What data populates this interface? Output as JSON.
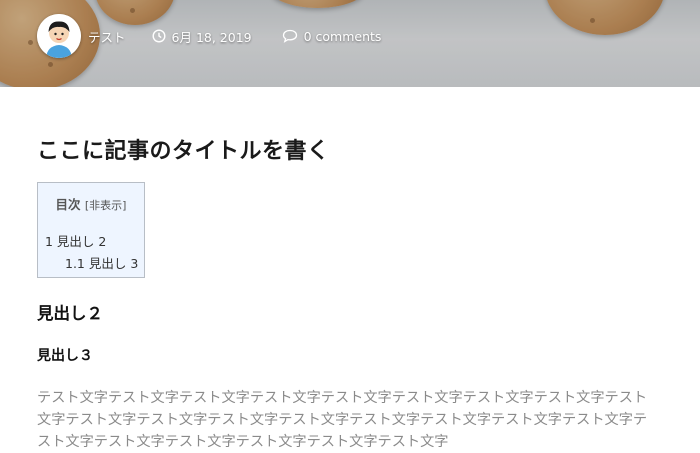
{
  "header": {
    "author": "テスト",
    "date": "6月 18, 2019",
    "comments": "0 comments",
    "icons": [
      "avatar",
      "clock-icon",
      "comment-icon"
    ]
  },
  "article": {
    "title": "ここに記事のタイトルを書く",
    "toc": {
      "heading": "目次",
      "toggle": "[非表示]",
      "items": [
        "1 見出し 2",
        "1.1 見出し 3"
      ]
    },
    "h2": "見出し２",
    "h3": "見出し３",
    "body": "テスト文字テスト文字テスト文字テスト文字テスト文字テスト文字テスト文字テスト文字テスト文字テスト文字テスト文字テスト文字テスト文字テスト文字テスト文字テスト文字テスト文字テスト文字テスト文字テスト文字テスト文字テスト文字テスト文字"
  },
  "colors": {
    "toc_background": "#eef5ff",
    "body_text": "#8a8a8a",
    "title_text": "#1a1a1a"
  }
}
